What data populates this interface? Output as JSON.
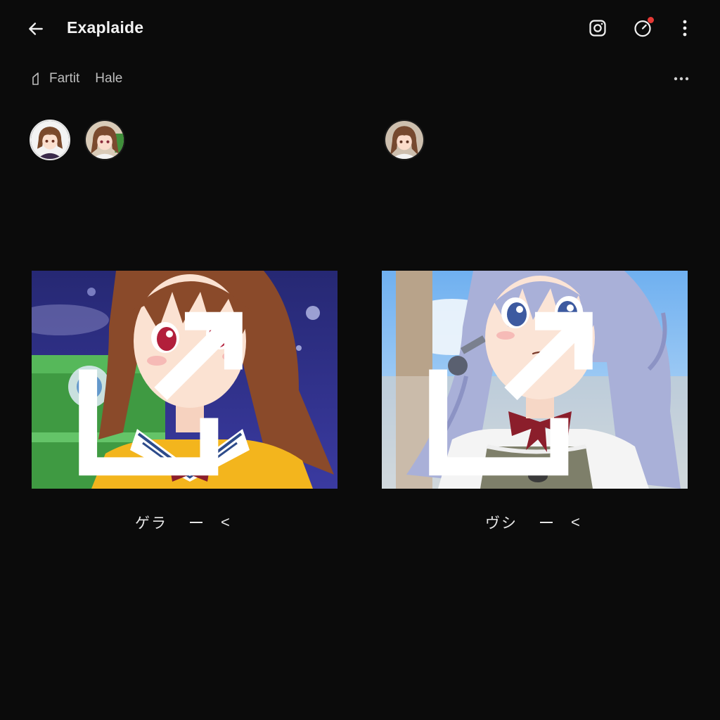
{
  "header": {
    "title": "Exaplaide",
    "icons": [
      "back-arrow-icon",
      "camera-icon",
      "timer-icon",
      "more-vertical-icon"
    ],
    "accent": "#e53935"
  },
  "subbar": {
    "tabs": [
      "Fartit",
      "Hale"
    ],
    "icons": [
      "folder-outline-icon",
      "more-horizontal-icon"
    ]
  },
  "cards": [
    {
      "caption": "ゲラ",
      "chevron": "<",
      "colors": {
        "hair": "#8a4a2a",
        "eyes": "#b21f3b",
        "sky": "#2a2a78",
        "ribbon": "#8b1e2b"
      }
    },
    {
      "caption": "ヴシ",
      "chevron": "<",
      "colors": {
        "hair": "#a9b0d8",
        "eyes": "#3d5aa0",
        "sky": "#7cb7f2",
        "ribbon": "#8b1e2b"
      }
    }
  ],
  "colors": {
    "background": "#0b0b0b",
    "text": "#ececec",
    "muted": "#bdbdbd"
  }
}
